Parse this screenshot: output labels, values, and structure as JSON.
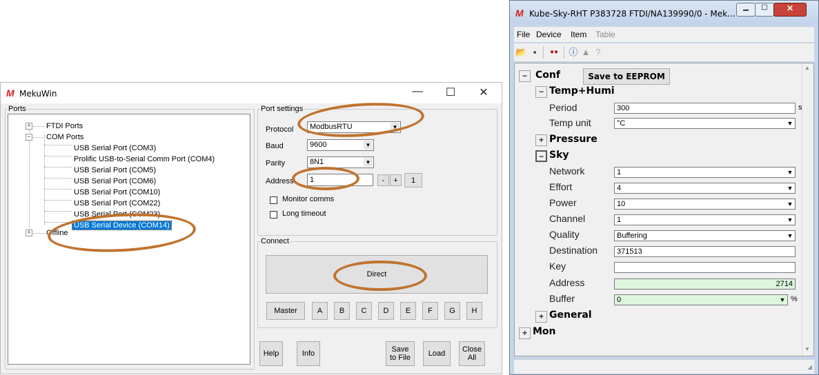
{
  "meku": {
    "title": "MekuWin",
    "window_controls": [
      "—",
      "☐",
      "✕"
    ],
    "ports_group": "Ports",
    "tree": {
      "ftdi": "FTDI Ports",
      "com": "COM Ports",
      "items": [
        "USB Serial Port (COM3)",
        "Prolific USB-to-Serial Comm Port (COM4)",
        "USB Serial Port (COM5)",
        "USB Serial Port (COM6)",
        "USB Serial Port (COM10)",
        "USB Serial Port (COM22)",
        "USB Serial Port (COM23)",
        "USB Serial Device (COM14)"
      ],
      "offline": "Offline"
    },
    "port_settings": {
      "group": "Port settings",
      "protocol_label": "Protocol",
      "protocol_value": "ModbusRTU",
      "baud_label": "Baud",
      "baud_value": "9600",
      "parity_label": "Parity",
      "parity_value": "8N1",
      "address_label": "Address",
      "address_value": "1",
      "minus": "-",
      "plus": "+",
      "one": "1",
      "monitor_comms": "Monitor comms",
      "long_timeout": "Long timeout"
    },
    "connect": {
      "group": "Connect",
      "direct": "Direct",
      "master": "Master",
      "letters": [
        "A",
        "B",
        "C",
        "D",
        "E",
        "F",
        "G",
        "H"
      ]
    },
    "bottom": {
      "help": "Help",
      "info": "Info",
      "save_line1": "Save",
      "save_line2": "to File",
      "load": "Load",
      "close_line1": "Close",
      "close_line2": "All"
    },
    "colors": {
      "accent": "#c0732f",
      "selection": "#0078d7"
    }
  },
  "kube": {
    "title": "Kube-Sky-RHT P383728 FTDI/NA139990/0 - Mek...",
    "menu": [
      "File",
      "Device",
      "Item",
      "Table"
    ],
    "conf": "Conf",
    "save_eeprom": "Save to EEPROM",
    "temp_humi": "Temp+Humi",
    "period_label": "Period",
    "period_value": "300",
    "period_unit": "s",
    "tempunit_label": "Temp unit",
    "tempunit_value": "°C",
    "pressure": "Pressure",
    "sky": "Sky",
    "fields": [
      {
        "label": "Network",
        "value": "1"
      },
      {
        "label": "Effort",
        "value": "4"
      },
      {
        "label": "Power",
        "value": "10"
      },
      {
        "label": "Channel",
        "value": "1"
      },
      {
        "label": "Quality",
        "value": "Buffering"
      },
      {
        "label": "Destination",
        "value": "371513"
      },
      {
        "label": "Key",
        "value": ""
      },
      {
        "label": "Address",
        "value": "2714"
      },
      {
        "label": "Buffer",
        "value": "0"
      }
    ],
    "buffer_unit": "%",
    "general": "General",
    "mon": "Mon"
  }
}
